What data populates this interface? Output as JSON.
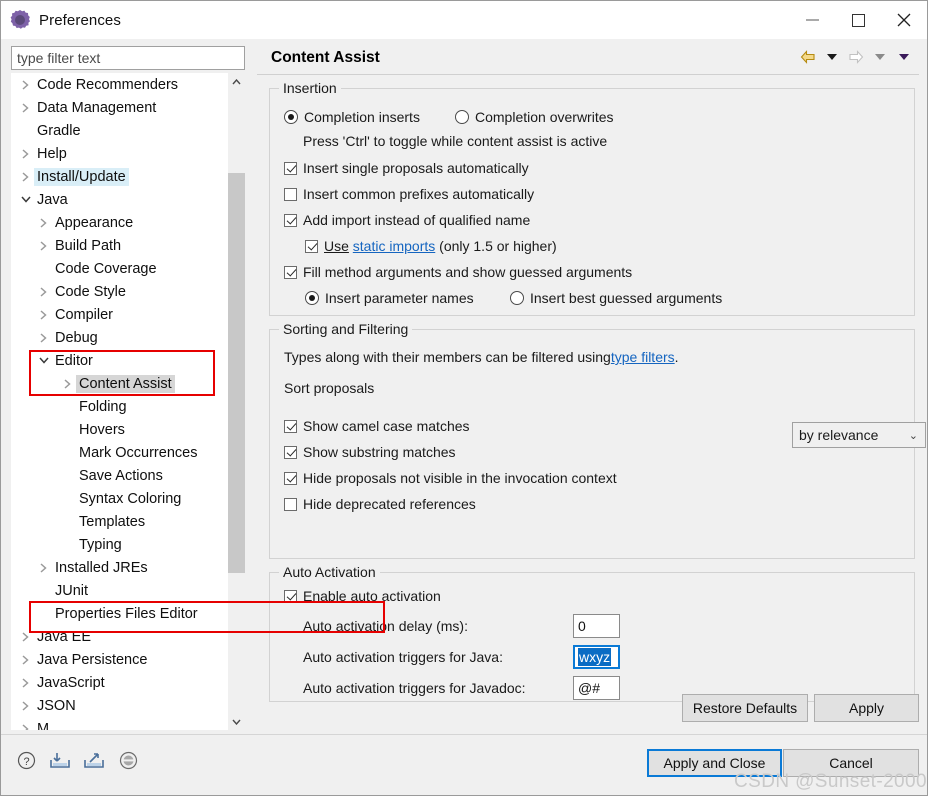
{
  "window": {
    "title": "Preferences",
    "icon": "cog-icon",
    "minimize_label": "—",
    "maximize_label": "□",
    "close_label": "✕"
  },
  "filter": {
    "placeholder": "type filter text",
    "value": ""
  },
  "tree": {
    "items": [
      {
        "label": "Code Recommenders",
        "level": 0,
        "twisty": "collapsed",
        "highlight": "none"
      },
      {
        "label": "Data Management",
        "level": 0,
        "twisty": "collapsed",
        "highlight": "none"
      },
      {
        "label": "Gradle",
        "level": 0,
        "twisty": "none",
        "highlight": "none"
      },
      {
        "label": "Help",
        "level": 0,
        "twisty": "collapsed",
        "highlight": "none"
      },
      {
        "label": "Install/Update",
        "level": 0,
        "twisty": "collapsed",
        "highlight": "blue"
      },
      {
        "label": "Java",
        "level": 0,
        "twisty": "expanded",
        "highlight": "none"
      },
      {
        "label": "Appearance",
        "level": 1,
        "twisty": "collapsed",
        "highlight": "none"
      },
      {
        "label": "Build Path",
        "level": 1,
        "twisty": "collapsed",
        "highlight": "none"
      },
      {
        "label": "Code Coverage",
        "level": 1,
        "twisty": "none",
        "highlight": "none"
      },
      {
        "label": "Code Style",
        "level": 1,
        "twisty": "collapsed",
        "highlight": "none"
      },
      {
        "label": "Compiler",
        "level": 1,
        "twisty": "collapsed",
        "highlight": "none"
      },
      {
        "label": "Debug",
        "level": 1,
        "twisty": "collapsed",
        "highlight": "none"
      },
      {
        "label": "Editor",
        "level": 1,
        "twisty": "expanded",
        "highlight": "none"
      },
      {
        "label": "Content Assist",
        "level": 2,
        "twisty": "collapsed",
        "highlight": "gray"
      },
      {
        "label": "Folding",
        "level": 2,
        "twisty": "none",
        "highlight": "none"
      },
      {
        "label": "Hovers",
        "level": 2,
        "twisty": "none",
        "highlight": "none"
      },
      {
        "label": "Mark Occurrences",
        "level": 2,
        "twisty": "none",
        "highlight": "none"
      },
      {
        "label": "Save Actions",
        "level": 2,
        "twisty": "none",
        "highlight": "none"
      },
      {
        "label": "Syntax Coloring",
        "level": 2,
        "twisty": "none",
        "highlight": "none"
      },
      {
        "label": "Templates",
        "level": 2,
        "twisty": "none",
        "highlight": "none"
      },
      {
        "label": "Typing",
        "level": 2,
        "twisty": "none",
        "highlight": "none"
      },
      {
        "label": "Installed JREs",
        "level": 1,
        "twisty": "collapsed",
        "highlight": "none"
      },
      {
        "label": "JUnit",
        "level": 1,
        "twisty": "none",
        "highlight": "none"
      },
      {
        "label": "Properties Files Editor",
        "level": 1,
        "twisty": "none",
        "highlight": "none"
      },
      {
        "label": "Java EE",
        "level": 0,
        "twisty": "collapsed",
        "highlight": "none"
      },
      {
        "label": "Java Persistence",
        "level": 0,
        "twisty": "collapsed",
        "highlight": "none"
      },
      {
        "label": "JavaScript",
        "level": 0,
        "twisty": "collapsed",
        "highlight": "none"
      },
      {
        "label": "JSON",
        "level": 0,
        "twisty": "collapsed",
        "highlight": "none"
      },
      {
        "label": "M",
        "level": 0,
        "twisty": "collapsed",
        "highlight": "none"
      }
    ],
    "scroll_up_icon": "chevron-up-icon",
    "scroll_down_icon": "chevron-down-icon"
  },
  "pane": {
    "title": "Content Assist",
    "nav": {
      "back_icon": "arrow-left-icon",
      "back_menu_icon": "caret-down-icon",
      "forward_icon": "arrow-right-icon",
      "forward_menu_icon": "caret-down-icon",
      "view_menu_icon": "caret-down-icon"
    }
  },
  "insertion": {
    "title": "Insertion",
    "radio_inserts": "Completion inserts",
    "radio_overwrites": "Completion overwrites",
    "hint": "Press 'Ctrl' to toggle while content assist is active",
    "cb_single": "Insert single proposals automatically",
    "cb_prefixes": "Insert common prefixes automatically",
    "cb_add_import": "Add import instead of qualified name",
    "cb_static_use": "Use",
    "cb_static_link": "static imports",
    "cb_static_tail": "(only 1.5 or higher)",
    "cb_fill_method": "Fill method arguments and show guessed arguments",
    "radio_param_names": "Insert parameter names",
    "radio_best_guessed": "Insert best guessed arguments"
  },
  "sorting": {
    "title": "Sorting and Filtering",
    "desc_pre": "Types along with their members can be filtered using ",
    "desc_link": "type filters",
    "desc_post": ".",
    "sort_label": "Sort proposals",
    "sort_value": "by relevance",
    "cb_camel": "Show camel case matches",
    "cb_substring": "Show substring matches",
    "cb_hide_invisible": "Hide proposals not visible in the invocation context",
    "cb_hide_deprecated": "Hide deprecated references"
  },
  "auto_activation": {
    "title": "Auto Activation",
    "cb_enable": "Enable auto activation",
    "delay_label": "Auto activation delay (ms):",
    "delay_value": "0",
    "java_label": "Auto activation triggers for Java:",
    "java_value": "wxyz",
    "javadoc_label": "Auto activation triggers for Javadoc:",
    "javadoc_value": "@#"
  },
  "buttons": {
    "restore_defaults": "Restore Defaults",
    "apply": "Apply",
    "apply_and_close": "Apply and Close",
    "cancel": "Cancel"
  },
  "bottom_icons": {
    "help": "help-icon",
    "import": "import-icon",
    "export": "export-icon",
    "filter": "filter-circle-icon"
  },
  "watermark": "CSDN @Sunset-2000",
  "colors": {
    "accent_blue": "#0a7ad6",
    "selection_blue": "#0a6cc4",
    "annotation_red": "#e60000",
    "link_blue": "#1565c0",
    "tree_blue_hl": "#d9eef7",
    "tree_gray_hl": "#d6d6d6",
    "nav_back": "#e8b93a",
    "nav_forward_disabled": "#c9c9c9",
    "cog_purple": "#7e62a8"
  }
}
